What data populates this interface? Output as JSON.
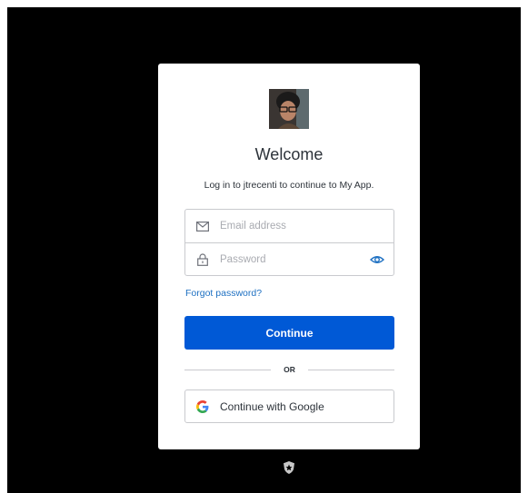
{
  "login": {
    "title": "Welcome",
    "subtitle": "Log in to jtrecenti to continue to My App.",
    "email_placeholder": "Email address",
    "password_placeholder": "Password",
    "forgot_password": "Forgot password?",
    "continue_label": "Continue",
    "divider_text": "OR",
    "google_label": "Continue with Google"
  },
  "colors": {
    "primary_button": "#0059d6",
    "link": "#1e70c2",
    "background": "#000000"
  }
}
